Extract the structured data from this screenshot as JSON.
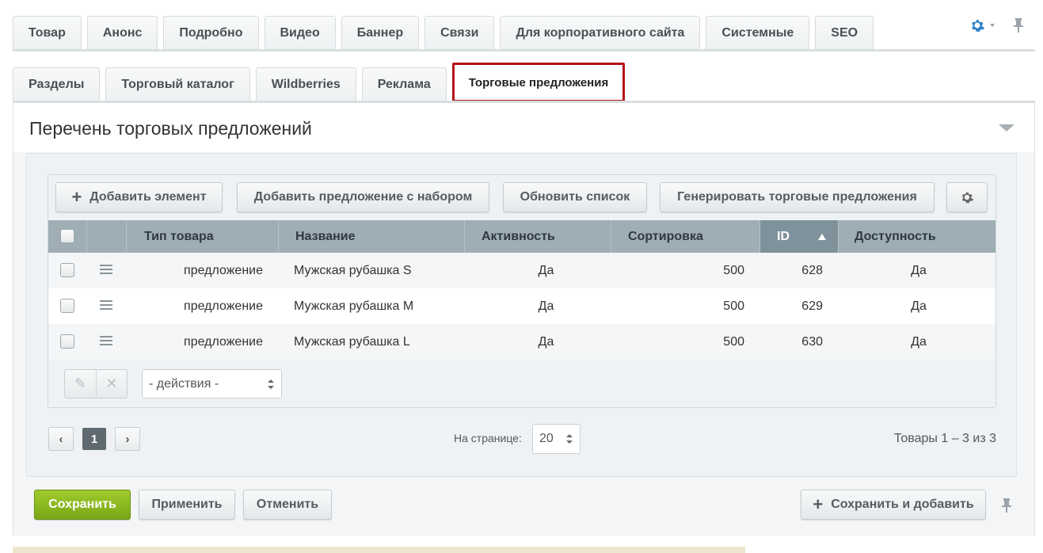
{
  "top_tabs": [
    "Товар",
    "Анонс",
    "Подробно",
    "Видео",
    "Баннер",
    "Связи",
    "Для корпоративного сайта",
    "Системные",
    "SEO"
  ],
  "sub_tabs": [
    "Разделы",
    "Торговый каталог",
    "Wildberries",
    "Реклама",
    "Торговые предложения"
  ],
  "panel_title": "Перечень торговых предложений",
  "toolbar": {
    "add_element": "Добавить элемент",
    "add_offer_set": "Добавить предложение с набором",
    "refresh": "Обновить список",
    "generate": "Генерировать торговые предложения"
  },
  "columns": [
    "Тип товара",
    "Название",
    "Активность",
    "Сортировка",
    "ID",
    "Доступность"
  ],
  "rows": [
    {
      "type": "предложение",
      "name": "Мужская рубашка S",
      "active": "Да",
      "sort": "500",
      "id": "628",
      "available": "Да"
    },
    {
      "type": "предложение",
      "name": "Мужская рубашка M",
      "active": "Да",
      "sort": "500",
      "id": "629",
      "available": "Да"
    },
    {
      "type": "предложение",
      "name": "Мужская рубашка L",
      "active": "Да",
      "sort": "500",
      "id": "630",
      "available": "Да"
    }
  ],
  "actions_select": "- действия -",
  "pager": {
    "current": "1",
    "per_page_label": "На странице:",
    "per_page": "20",
    "summary": "Товары 1 – 3 из 3"
  },
  "footer": {
    "save": "Сохранить",
    "apply": "Применить",
    "cancel": "Отменить",
    "save_and_add": "Сохранить и добавить"
  },
  "colors": {
    "active_tab_border": "#b3131a",
    "save_green": "#8bb825",
    "header_gray": "#9fadb5",
    "gear_blue": "#2d7fc4"
  }
}
